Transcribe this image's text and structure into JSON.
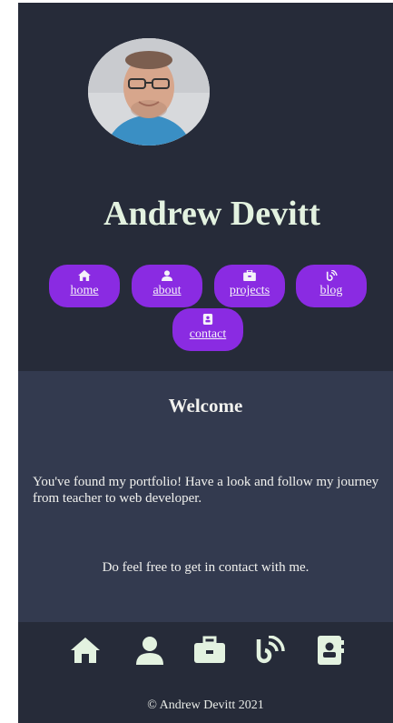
{
  "header": {
    "name": "Andrew Devitt"
  },
  "nav": {
    "items": [
      {
        "label": "home",
        "icon": "home-icon"
      },
      {
        "label": "about",
        "icon": "user-icon"
      },
      {
        "label": "projects",
        "icon": "briefcase-icon"
      },
      {
        "label": "blog",
        "icon": "blog-rss-icon"
      },
      {
        "label": "contact",
        "icon": "contact-card-icon"
      }
    ]
  },
  "welcome": {
    "title": "Welcome",
    "text1": "You've found my portfolio! Have a look and follow my journey from teacher to web developer.",
    "text2": "Do feel free to get in contact with me."
  },
  "footer": {
    "copyright": "© Andrew Devitt 2021",
    "icons": [
      "home-icon",
      "user-icon",
      "briefcase-icon",
      "blog-rss-icon",
      "contact-card-icon"
    ]
  },
  "colors": {
    "background": "#262b39",
    "section": "#333a4f",
    "accent": "#8a2be2",
    "name_text": "#e3f2e0"
  }
}
